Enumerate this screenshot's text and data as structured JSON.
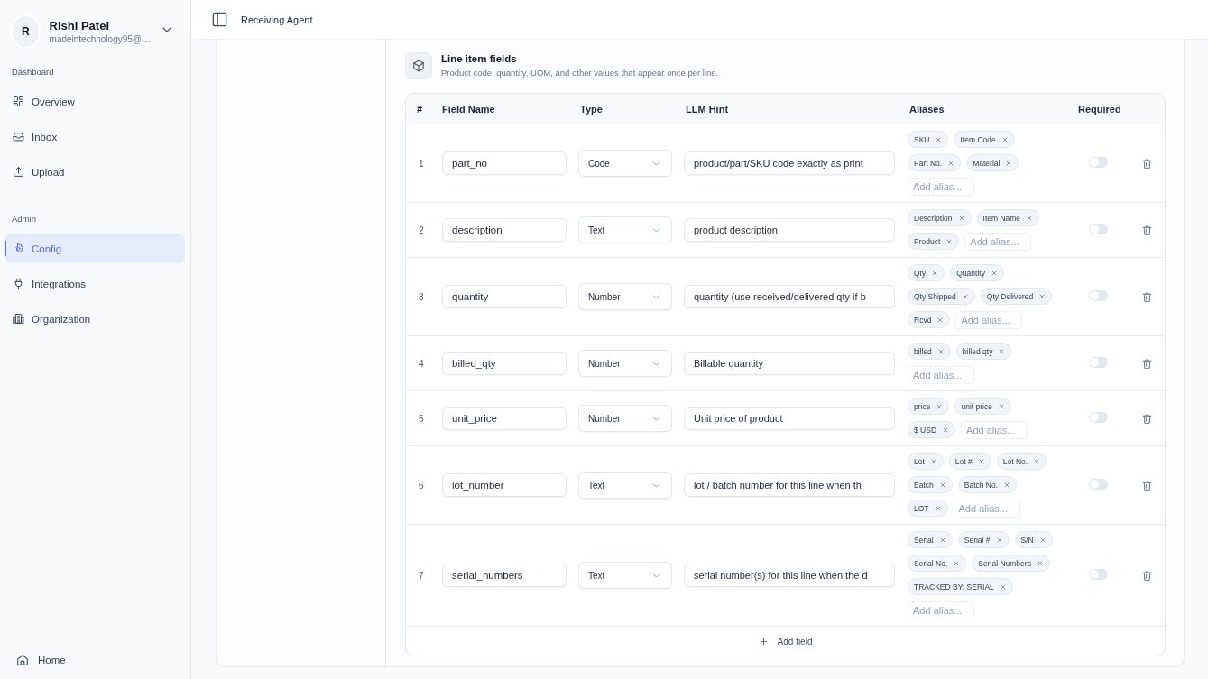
{
  "sidebar": {
    "user": {
      "initial": "R",
      "name": "Rishi Patel",
      "email": "madeintechnology95@…"
    },
    "sections": [
      {
        "heading": "Dashboard",
        "items": [
          {
            "label": "Overview",
            "selected": false
          },
          {
            "label": "Inbox",
            "selected": false
          },
          {
            "label": "Upload",
            "selected": false
          }
        ]
      },
      {
        "heading": "Admin",
        "items": [
          {
            "label": "Config",
            "selected": true
          },
          {
            "label": "Integrations",
            "selected": false
          },
          {
            "label": "Organization",
            "selected": false
          }
        ]
      }
    ],
    "footer_item": {
      "label": "Home"
    }
  },
  "header": {
    "title": "Receiving Agent"
  },
  "section": {
    "title": "Line item fields",
    "subtitle": "Product code, quantity, UOM, and other values that appear once per line."
  },
  "table": {
    "columns": [
      "#",
      "Field Name",
      "Type",
      "LLM Hint",
      "Aliases",
      "Required"
    ],
    "rows": [
      {
        "index": "1",
        "field_name": "part_no",
        "type": "Code",
        "hint": "product/part/SKU code exactly as print",
        "aliases": [
          "SKU",
          "Item Code",
          "Part No.",
          "Material"
        ],
        "alias_placeholder": "Add alias...",
        "required": false
      },
      {
        "index": "2",
        "field_name": "description",
        "type": "Text",
        "hint": "product description",
        "aliases": [
          "Description",
          "Item Name",
          "Product"
        ],
        "alias_placeholder": "Add alias...",
        "required": false
      },
      {
        "index": "3",
        "field_name": "quantity",
        "type": "Number",
        "hint": "quantity (use received/delivered qty if b",
        "aliases": [
          "Qty",
          "Quantity",
          "Qty Shipped",
          "Qty Delivered",
          "Rcvd"
        ],
        "alias_placeholder": "Add alias...",
        "required": false
      },
      {
        "index": "4",
        "field_name": "billed_qty",
        "type": "Number",
        "hint": "Billable quantity",
        "aliases": [
          "billed",
          "billed qty"
        ],
        "alias_placeholder": "Add alias...",
        "required": false
      },
      {
        "index": "5",
        "field_name": "unit_price",
        "type": "Number",
        "hint": "Unit price of product",
        "aliases": [
          "price",
          "unit price",
          "$ USD"
        ],
        "alias_placeholder": "Add alias...",
        "required": false
      },
      {
        "index": "6",
        "field_name": "lot_number",
        "type": "Text",
        "hint": "lot / batch number for this line when th",
        "aliases": [
          "Lot",
          "Lot #",
          "Lot No.",
          "Batch",
          "Batch No.",
          "LOT"
        ],
        "alias_placeholder": "Add alias...",
        "required": false
      },
      {
        "index": "7",
        "field_name": "serial_numbers",
        "type": "Text",
        "hint": "serial number(s) for this line when the d",
        "aliases": [
          "Serial",
          "Serial #",
          "S/N",
          "Serial No.",
          "Serial Numbers",
          "TRACKED BY: SERIAL"
        ],
        "alias_placeholder": "Add alias...",
        "required": false
      }
    ],
    "add_button": "Add field"
  }
}
